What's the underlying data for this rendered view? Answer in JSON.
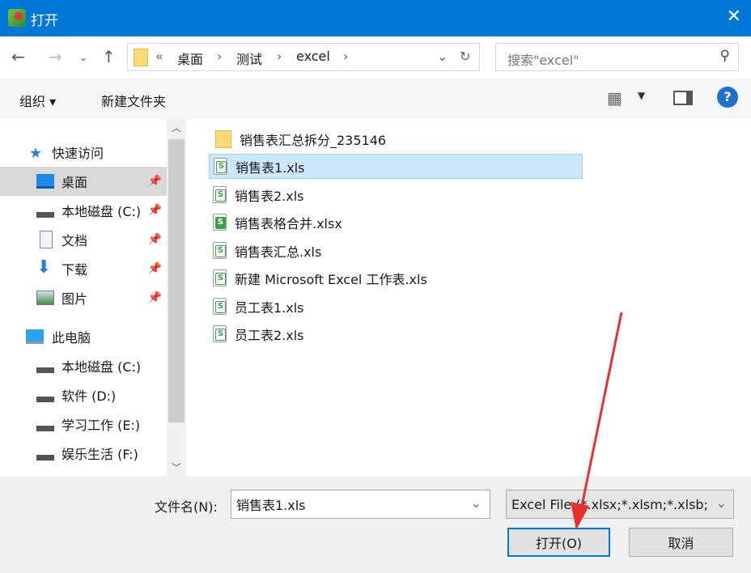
{
  "title": "打开",
  "address": {
    "sep": "«",
    "crumbs": [
      "桌面",
      "测试",
      "excel"
    ]
  },
  "search": {
    "placeholder": "搜索\"excel\""
  },
  "toolbar": {
    "organize": "组织 ▾",
    "new_folder": "新建文件夹",
    "help": "?"
  },
  "nav": {
    "quick": "快速访问",
    "quick_items": [
      "桌面",
      "本地磁盘 (C:)",
      "文档",
      "下载",
      "图片"
    ],
    "pc": "此电脑",
    "pc_items": [
      "本地磁盘 (C:)",
      "软件 (D:)",
      "学习工作 (E:)",
      "娱乐生活 (F:)"
    ]
  },
  "files": [
    "销售表汇总拆分_235146",
    "销售表1.xls",
    "销售表2.xls",
    "销售表格合并.xlsx",
    "销售表汇总.xls",
    "新建 Microsoft Excel 工作表.xls",
    "员工表1.xls",
    "员工表2.xls"
  ],
  "filename": {
    "label": "文件名(N):",
    "value": "销售表1.xls"
  },
  "filetype": "Excel File (*.xlsx;*.xlsm;*.xlsb;",
  "buttons": {
    "open": "打开(O)",
    "cancel": "取消"
  },
  "colors": {
    "accent": "#0078d7",
    "annotation_arrow": "#e8302f"
  }
}
